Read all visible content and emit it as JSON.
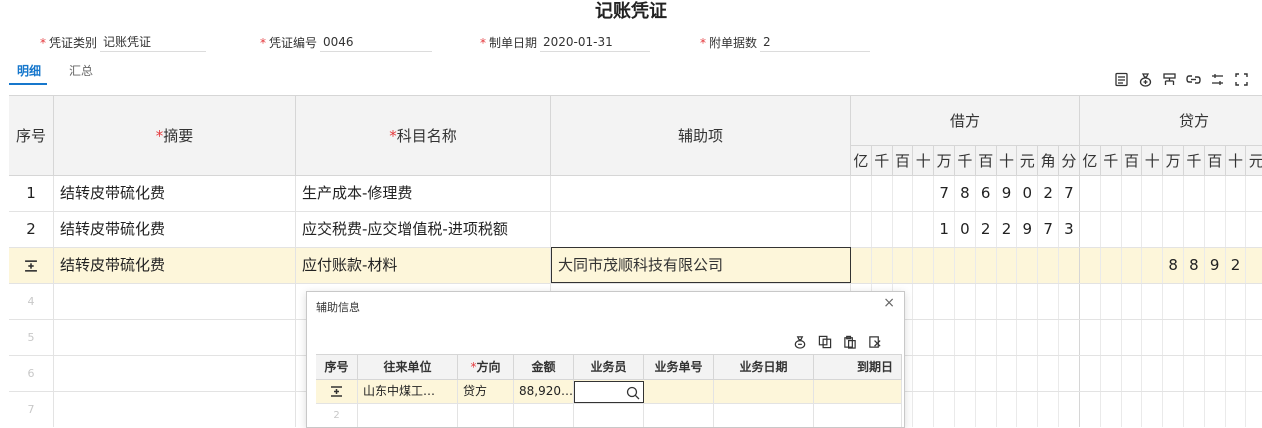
{
  "page": {
    "title": "记账凭证"
  },
  "header": {
    "fields": [
      {
        "label": "凭证类别",
        "value": "记账凭证"
      },
      {
        "label": "凭证编号",
        "value": "0046"
      },
      {
        "label": "制单日期",
        "value": "2020-01-31"
      },
      {
        "label": "附单据数",
        "value": "2"
      }
    ]
  },
  "tabs": [
    {
      "label": "明细"
    },
    {
      "label": "汇总"
    }
  ],
  "toolbar": {
    "icons": [
      "insert-row-icon",
      "money-bag-icon",
      "org-chart-icon",
      "link-icon",
      "adjust-columns-icon",
      "fullscreen-icon"
    ]
  },
  "grid": {
    "columns": {
      "seq": "序号",
      "summary": "摘要",
      "account": "科目名称",
      "aux": "辅助项",
      "debit": "借方",
      "credit": "贷方"
    },
    "digit_headers_debit": [
      "亿",
      "千",
      "百",
      "十",
      "万",
      "千",
      "百",
      "十",
      "元",
      "角",
      "分"
    ],
    "digit_headers_credit": [
      "亿",
      "千",
      "百",
      "十",
      "万",
      "千",
      "百",
      "十",
      "元"
    ],
    "rows": [
      {
        "seq": "1",
        "summary": "结转皮带硫化费",
        "account": "生产成本-修理费",
        "aux": "",
        "debit": "7869027",
        "credit": ""
      },
      {
        "seq": "2",
        "summary": "结转皮带硫化费",
        "account": "应交税费-应交增值税-进项税额",
        "aux": "",
        "debit": "1022973",
        "credit": ""
      },
      {
        "seq": "",
        "summary": "结转皮带硫化费",
        "account": "应付账款-材料",
        "aux": "大同市茂顺科技有限公司",
        "debit": "",
        "credit": "8892"
      },
      {
        "seq": "4",
        "summary": "",
        "account": "",
        "aux": "",
        "debit": "",
        "credit": ""
      },
      {
        "seq": "5",
        "summary": "",
        "account": "",
        "aux": "",
        "debit": "",
        "credit": ""
      },
      {
        "seq": "6",
        "summary": "",
        "account": "",
        "aux": "",
        "debit": "",
        "credit": ""
      },
      {
        "seq": "7",
        "summary": "",
        "account": "",
        "aux": "",
        "debit": "",
        "credit": ""
      }
    ]
  },
  "popup": {
    "title": "辅助信息",
    "close": "×",
    "tools": [
      "money-bag-icon",
      "copy-icon",
      "paste-icon",
      "delete-icon"
    ],
    "columns": [
      "序号",
      "往来单位",
      "方向",
      "金额",
      "业务员",
      "业务单号",
      "业务日期",
      "到期日"
    ],
    "rows": [
      {
        "seq": "",
        "unit": "山东中煤工…",
        "direction": "贷方",
        "amount": "88,920…",
        "salesman": "",
        "bizno": "",
        "bizdate": "",
        "due": ""
      },
      {
        "seq": "2",
        "unit": "",
        "direction": "",
        "amount": "",
        "salesman": "",
        "bizno": "",
        "bizdate": "",
        "due": ""
      }
    ]
  },
  "colors": {
    "accent": "#1677cc",
    "required": "#e4393c",
    "selected_row": "#fdf6da",
    "header_bg": "#f3f3f3"
  }
}
